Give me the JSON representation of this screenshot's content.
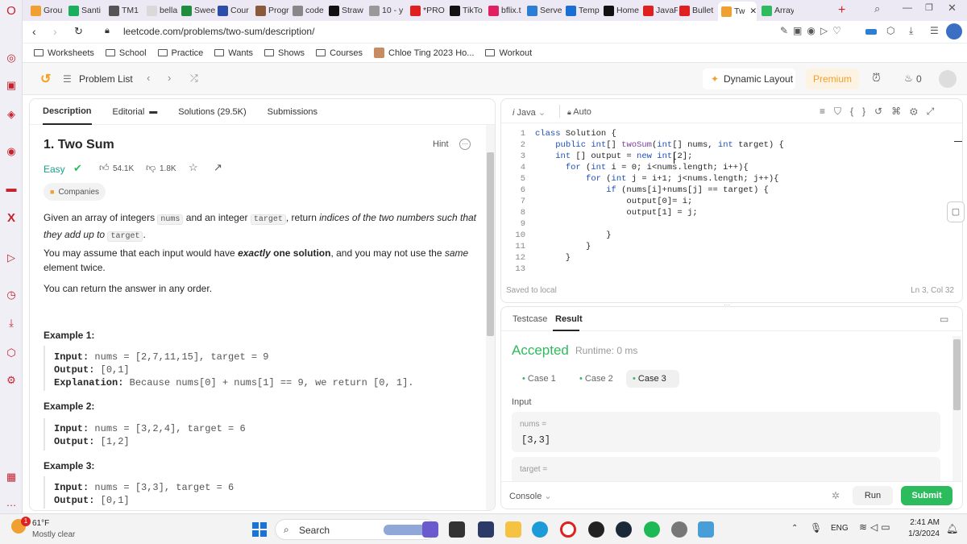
{
  "browser": {
    "tabs": [
      {
        "label": "Grou",
        "color": "#f0a030"
      },
      {
        "label": "Santi",
        "color": "#1aaf5d"
      },
      {
        "label": "TM1",
        "color": "#555555"
      },
      {
        "label": "bella",
        "color": "#d9d9d9"
      },
      {
        "label": "Swee",
        "color": "#1e8e3e"
      },
      {
        "label": "Cour",
        "color": "#2b4fa8"
      },
      {
        "label": "Progr",
        "color": "#8a5a3a"
      },
      {
        "label": "code",
        "color": "#888888"
      },
      {
        "label": "Straw",
        "color": "#111111"
      },
      {
        "label": "10 - y",
        "color": "#999999"
      },
      {
        "label": "*PRO",
        "color": "#e02020"
      },
      {
        "label": "TikTo",
        "color": "#111111"
      },
      {
        "label": "bflix.t",
        "color": "#e02060"
      },
      {
        "label": "Serve",
        "color": "#2a7fd4"
      },
      {
        "label": "Temp",
        "color": "#1a6fd4"
      },
      {
        "label": "Home",
        "color": "#111111"
      },
      {
        "label": "JavaF",
        "color": "#e02020"
      },
      {
        "label": "Bullet",
        "color": "#e02020"
      },
      {
        "label": "Tw",
        "color": "#f0a030"
      },
      {
        "label": "Array",
        "color": "#2cbb5d"
      }
    ],
    "url": "leetcode.com/problems/two-sum/description/",
    "bookmarks": [
      "Worksheets",
      "School",
      "Practice",
      "Wants",
      "Shows",
      "Courses",
      "Chloe Ting 2023 Ho...",
      "Workout"
    ]
  },
  "lc_header": {
    "problem_list": "Problem List",
    "dynamic_layout": "Dynamic Layout",
    "premium": "Premium",
    "streak": "0"
  },
  "left": {
    "tabs": [
      "Description",
      "Editorial",
      "Solutions (29.5K)",
      "Submissions"
    ],
    "title": "1. Two Sum",
    "hint": "Hint",
    "difficulty": "Easy",
    "likes": "54.1K",
    "dislikes": "1.8K",
    "companies": "Companies",
    "desc1_a": "Given an array of integers",
    "desc1_nums": "nums",
    "desc1_b": "and an integer",
    "desc1_target": "target",
    "desc1_c": ", return",
    "desc1_italic": "indices of the two numbers such that they add",
    "desc1_italic2": "up to",
    "desc1_target2": "target",
    "desc1_end": ".",
    "desc2_a": "You may assume that each input would have",
    "desc2_bold_i": "exactly",
    "desc2_bold": "one solution",
    "desc2_b": ", and you may not use the",
    "desc2_i": "same",
    "desc2_c": "element",
    "desc2_d": "twice.",
    "desc3": "You can return the answer in any order.",
    "ex1_title": "Example 1:",
    "ex1_input_k": "Input:",
    "ex1_input_v": "nums = [2,7,11,15], target = 9",
    "ex1_output_k": "Output:",
    "ex1_output_v": "[0,1]",
    "ex1_expl_k": "Explanation:",
    "ex1_expl_v": "Because nums[0] + nums[1] == 9, we return [0, 1].",
    "ex2_title": "Example 2:",
    "ex2_input_k": "Input:",
    "ex2_input_v": "nums = [3,2,4], target = 6",
    "ex2_output_k": "Output:",
    "ex2_output_v": "[1,2]",
    "ex3_title": "Example 3:",
    "ex3_input_k": "Input:",
    "ex3_input_v": "nums = [3,3], target = 6",
    "ex3_output_k": "Output:",
    "ex3_output_v": "[0,1]"
  },
  "editor": {
    "language": "Java",
    "mode": "Auto",
    "lines": [
      "class Solution {",
      "    public int[] twoSum(int[] nums, int target) {",
      "    int [] output = new int[2];",
      "      for (int i = 0; i<nums.length; i++){",
      "          for (int j = i+1; j<nums.length; j++){",
      "              if (nums[i]+nums[j] == target) {",
      "                  output[0]= i;",
      "                  output[1] = j;",
      "",
      "              }",
      "          }",
      "      }",
      ""
    ],
    "status": "Saved to local",
    "cursor": "Ln 3, Col 32"
  },
  "result": {
    "tabs": [
      "Testcase",
      "Result"
    ],
    "status": "Accepted",
    "runtime": "Runtime: 0 ms",
    "cases": [
      "Case 1",
      "Case 2",
      "Case 3"
    ],
    "input_label": "Input",
    "var1_label": "nums =",
    "var1_value": "[3,3]",
    "var2_label": "target =",
    "console": "Console",
    "run": "Run",
    "submit": "Submit"
  },
  "taskbar": {
    "weather_temp": "61°F",
    "weather_desc": "Mostly clear",
    "search": "Search",
    "lang": "ENG",
    "time": "2:41 AM",
    "date": "1/3/2024",
    "notif_count": "1"
  }
}
